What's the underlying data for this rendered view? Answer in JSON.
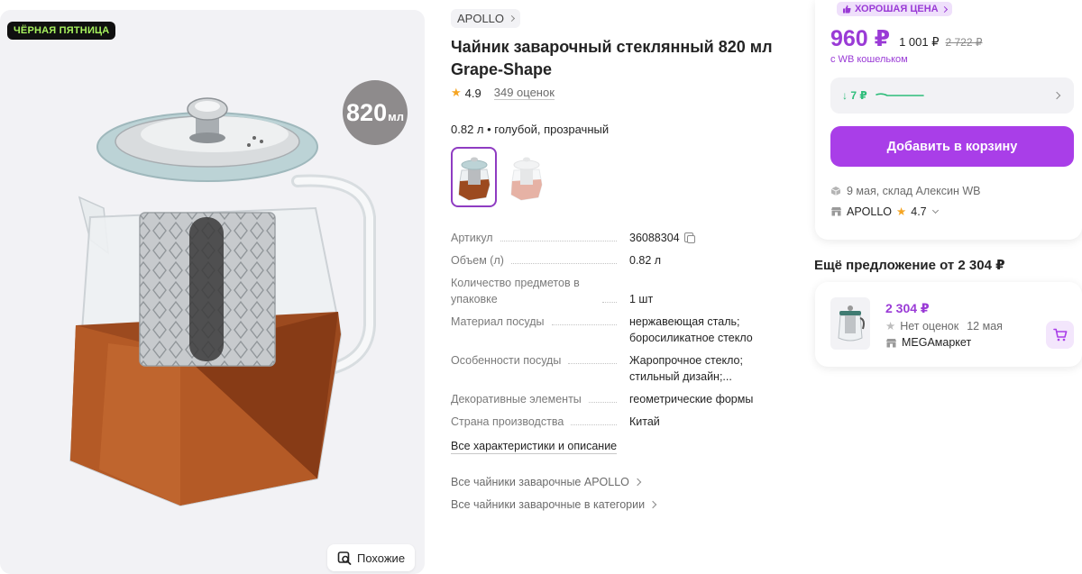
{
  "gallery": {
    "promo_badge": "ЧЁРНАЯ ПЯТНИЦА",
    "volume_number": "820",
    "volume_unit": "мл",
    "similar_label": "Похожие"
  },
  "product": {
    "brand": "APOLLO",
    "title": "Чайник заварочный стеклянный 820 мл Grape-Shape",
    "rating": "4.9",
    "reviews": "349 оценок",
    "variant_label": "0.82 л • голубой, прозрачный"
  },
  "specs": [
    {
      "key": "Артикул",
      "value": "36088304"
    },
    {
      "key": "Объем (л)",
      "value": "0.82 л"
    },
    {
      "key": "Количество предметов в упаковке",
      "value": "1 шт"
    },
    {
      "key": "Материал посуды",
      "value": "нержавеющая сталь; боросиликатное стекло"
    },
    {
      "key": "Особенности посуды",
      "value": "Жаропрочное стекло; стильный дизайн;..."
    },
    {
      "key": "Декоративные элементы",
      "value": "геометрические формы"
    },
    {
      "key": "Страна производства",
      "value": "Китай"
    }
  ],
  "links": {
    "all_specs": "Все характеристики и описание",
    "brand_link": "Все чайники заварочные APOLLO",
    "category_link": "Все чайники заварочные в категории"
  },
  "price_card": {
    "good_price_badge": "ХОРОШАЯ ЦЕНА",
    "price": "960 ₽",
    "price_regular": "1 001 ₽",
    "price_old": "2 722 ₽",
    "wallet_note": "с WB кошельком",
    "price_drop": "↓ 7 ₽",
    "add_to_cart": "Добавить в корзину",
    "delivery": "9 мая, склад Алексин WB",
    "seller": "APOLLO",
    "seller_rating": "4.7"
  },
  "other_offer": {
    "heading": "Ещё предложение от 2 304 ₽",
    "price": "2 304 ₽",
    "rating_text": "Нет оценок",
    "date": "12 мая",
    "seller": "MEGAмаркет"
  },
  "colors": {
    "accent": "#a93ee8",
    "price_purple": "#9a3bd6",
    "promo_green": "#a7f15e",
    "drop_green": "#2ebd7a",
    "star": "#f5a523"
  }
}
